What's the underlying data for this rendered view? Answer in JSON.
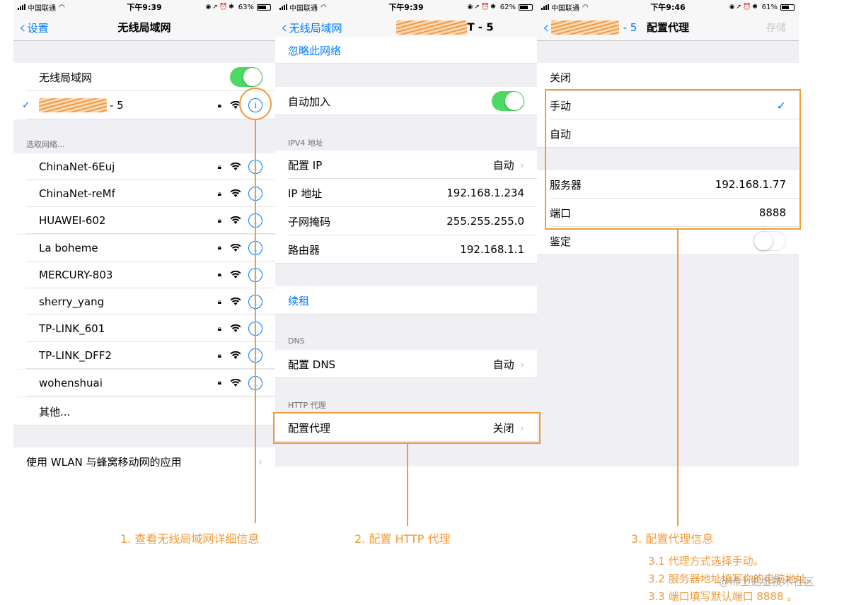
{
  "colors": {
    "accent": "#f29a38",
    "ios_blue": "#007aff",
    "switch_green": "#4cd964"
  },
  "phone1": {
    "status": {
      "carrier": "中国联通",
      "time": "下午9:39",
      "battery": "63%"
    },
    "nav": {
      "back": "设置",
      "title": "无线局域网"
    },
    "wlan_label": "无线局域网",
    "wlan_on": true,
    "connected_suffix": "- 5",
    "choose_header": "选取网络...",
    "networks": [
      "ChinaNet-6Euj",
      "ChinaNet-reMf",
      "HUAWEI-602",
      "La boheme",
      "MERCURY-803",
      "sherry_yang",
      "TP-LINK_601",
      "TP-LINK_DFF2",
      "wohenshuai"
    ],
    "other": "其他...",
    "apps_row": "使用 WLAN 与蜂窝移动网的应用"
  },
  "phone2": {
    "status": {
      "carrier": "中国联通",
      "time": "下午9:39",
      "battery": "62%"
    },
    "nav": {
      "back": "无线局域网",
      "title_suffix": "T - 5"
    },
    "forget": "忽略此网络",
    "auto_join": "自动加入",
    "auto_join_on": true,
    "ipv4_header": "IPV4 地址",
    "ipv4": [
      {
        "label": "配置 IP",
        "value": "自动",
        "arrow": true
      },
      {
        "label": "IP 地址",
        "value": "192.168.1.234"
      },
      {
        "label": "子网掩码",
        "value": "255.255.255.0"
      },
      {
        "label": "路由器",
        "value": "192.168.1.1"
      }
    ],
    "renew": "续租",
    "dns_header": "DNS",
    "dns": {
      "label": "配置 DNS",
      "value": "自动"
    },
    "proxy_header": "HTTP 代理",
    "proxy": {
      "label": "配置代理",
      "value": "关闭"
    }
  },
  "phone3": {
    "status": {
      "carrier": "中国联通",
      "time": "下午9:46",
      "battery": "61%"
    },
    "nav": {
      "back_suffix": "- 5",
      "title": "配置代理",
      "save": "存储"
    },
    "off": "关闭",
    "manual": "手动",
    "auto": "自动",
    "server": {
      "label": "服务器",
      "value": "192.168.1.77"
    },
    "port": {
      "label": "端口",
      "value": "8888"
    },
    "auth": "鉴定",
    "auth_on": false
  },
  "captions": {
    "step1": "1. 查看无线局域网详细信息",
    "step2": "2. 配置 HTTP 代理",
    "step3": "3. 配置代理信息",
    "step3_1": "3.1 代理方式选择手动。",
    "step3_2": "3.2 服务器地址填写你的电脑地址。",
    "step3_3": "3.3 端口填写默认端口 8888 。"
  },
  "watermark": "@稀土掘金技术社区"
}
